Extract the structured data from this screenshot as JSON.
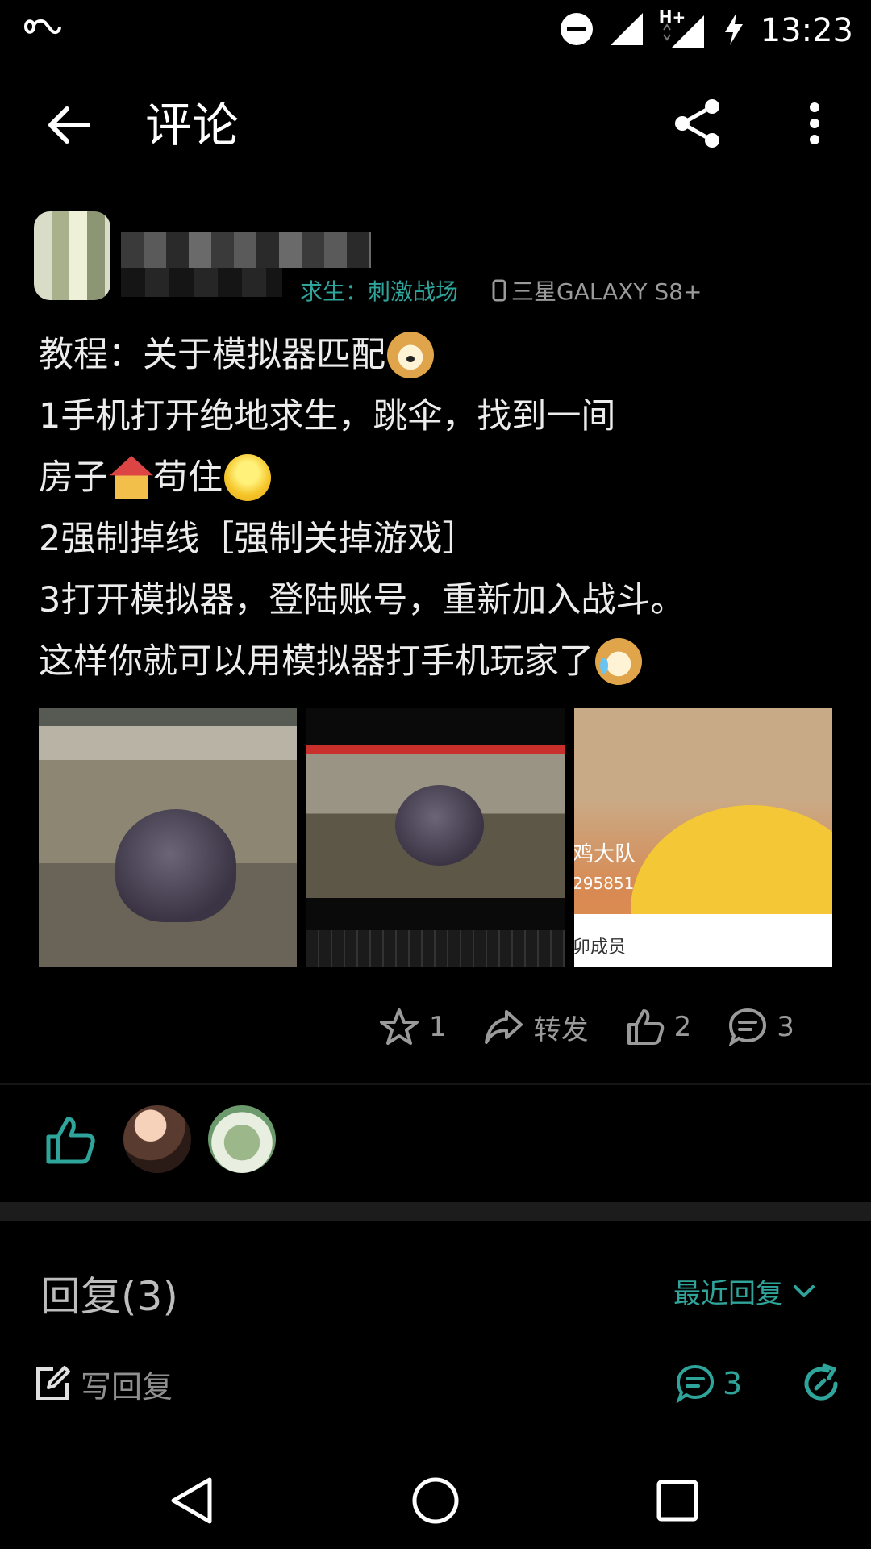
{
  "status_bar": {
    "time": "13:23",
    "network": "H+"
  },
  "app_bar": {
    "title": "评论"
  },
  "author": {
    "game_tag": "求生：刺激战场",
    "device": "三星GALAXY S8+"
  },
  "post": {
    "lines": [
      "教程：关于模拟器匹配",
      "1手机打开绝地求生，跳伞，找到一间",
      "房子",
      "苟住",
      "2强制掉线［强制关掉游戏］",
      "3打开模拟器，登陆账号，重新加入战斗。",
      "这样你就可以用模拟器打手机玩家了"
    ],
    "image3_texts": [
      "鸡大队",
      "295851",
      "卯成员"
    ]
  },
  "actions": {
    "favorite_count": "1",
    "forward_label": "转发",
    "like_count": "2",
    "comment_count": "3"
  },
  "replies": {
    "title": "回复(3)",
    "sort_label": "最近回复"
  },
  "bottom_bar": {
    "write_placeholder": "写回复",
    "reply_count": "3"
  },
  "colors": {
    "accent": "#2fa49a",
    "background": "#000000",
    "text": "#ececec",
    "muted": "#9a9a9a"
  }
}
